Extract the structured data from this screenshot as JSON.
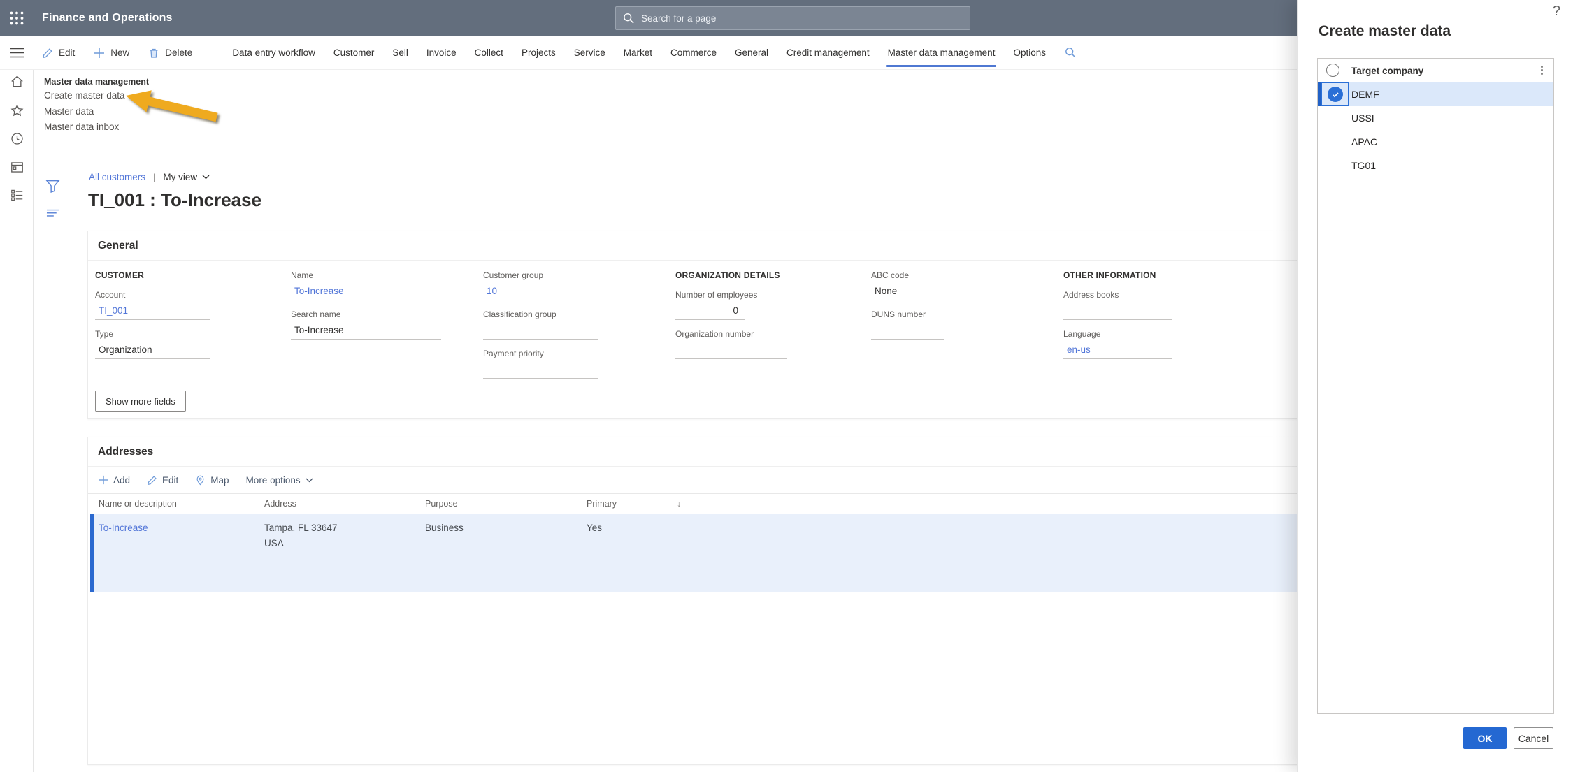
{
  "colors": {
    "app_bar_bg": "#636e7d",
    "accent_blue": "#2a6fd6",
    "link_blue": "#5276d8",
    "selection_bg": "#dbe8fa",
    "tab_underline": "#4f78d2",
    "annotation_arrow": "#efaa1f"
  },
  "app_bar": {
    "title": "Finance and Operations",
    "search_placeholder": "Search for a page"
  },
  "command_bar": {
    "actions": [
      {
        "label": "Edit",
        "icon": "pencil-icon"
      },
      {
        "label": "New",
        "icon": "plus-icon"
      },
      {
        "label": "Delete",
        "icon": "trash-icon"
      }
    ],
    "tabs": [
      {
        "label": "Data entry workflow",
        "active": false
      },
      {
        "label": "Customer",
        "active": false
      },
      {
        "label": "Sell",
        "active": false
      },
      {
        "label": "Invoice",
        "active": false
      },
      {
        "label": "Collect",
        "active": false
      },
      {
        "label": "Projects",
        "active": false
      },
      {
        "label": "Service",
        "active": false
      },
      {
        "label": "Market",
        "active": false
      },
      {
        "label": "Commerce",
        "active": false
      },
      {
        "label": "General",
        "active": false
      },
      {
        "label": "Credit management",
        "active": false
      },
      {
        "label": "Master data management",
        "active": true
      },
      {
        "label": "Options",
        "active": false
      }
    ]
  },
  "module_menu": {
    "header": "Master data management",
    "items": [
      "Create master data",
      "Master data",
      "Master data inbox"
    ]
  },
  "page": {
    "breadcrumb_link": "All customers",
    "separator": "|",
    "view_selector": "My view",
    "title": "TI_001 : To-Increase"
  },
  "general": {
    "title": "General",
    "customer_header": "CUSTOMER",
    "org_header": "ORGANIZATION DETAILS",
    "other_header": "OTHER INFORMATION",
    "fields": {
      "account": {
        "label": "Account",
        "value": "TI_001"
      },
      "type": {
        "label": "Type",
        "value": "Organization"
      },
      "name": {
        "label": "Name",
        "value": "To-Increase"
      },
      "search_name": {
        "label": "Search name",
        "value": "To-Increase"
      },
      "customer_group": {
        "label": "Customer group",
        "value": "10"
      },
      "classification_group": {
        "label": "Classification group",
        "value": ""
      },
      "payment_priority": {
        "label": "Payment priority",
        "value": ""
      },
      "number_of_employees": {
        "label": "Number of employees",
        "value": "0"
      },
      "organization_number": {
        "label": "Organization number",
        "value": ""
      },
      "abc_code": {
        "label": "ABC code",
        "value": "None"
      },
      "duns_number": {
        "label": "DUNS number",
        "value": ""
      },
      "address_books": {
        "label": "Address books",
        "value": ""
      },
      "language": {
        "label": "Language",
        "value": "en-us"
      }
    },
    "show_more_label": "Show more fields"
  },
  "addresses": {
    "title": "Addresses",
    "toolbar": {
      "add": "Add",
      "edit": "Edit",
      "map": "Map",
      "more": "More options"
    },
    "columns": [
      "Name or description",
      "Address",
      "Purpose",
      "Primary"
    ],
    "sort_glyph": "↓",
    "rows": [
      {
        "name": "To-Increase",
        "address_line1": "Tampa, FL 33647",
        "address_line2": "USA",
        "purpose": "Business",
        "primary": "Yes"
      }
    ]
  },
  "panel": {
    "help_glyph": "?",
    "title": "Create master data",
    "grid_header": "Target company",
    "more_glyph": "⋮",
    "companies": [
      {
        "name": "DEMF",
        "selected": true
      },
      {
        "name": "USSI",
        "selected": false
      },
      {
        "name": "APAC",
        "selected": false
      },
      {
        "name": "TG01",
        "selected": false
      }
    ],
    "ok_label": "OK",
    "cancel_label": "Cancel"
  }
}
